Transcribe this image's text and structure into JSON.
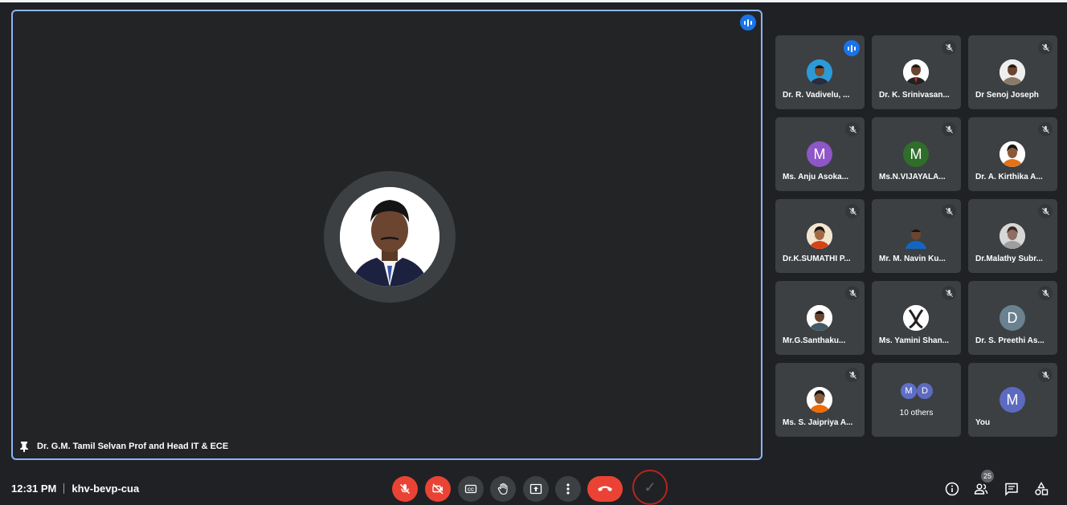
{
  "main": {
    "name": "Dr. G.M. Tamil Selvan Prof and Head IT & ECE"
  },
  "participants": [
    {
      "name": "Dr. R. Vadivelu, ...",
      "avatar": "photo",
      "speaking": true
    },
    {
      "name": "Dr. K. Srinivasan...",
      "avatar": "photo",
      "muted": true
    },
    {
      "name": "Dr Senoj Joseph",
      "avatar": "photo",
      "muted": true
    },
    {
      "name": "Ms. Anju Asoka...",
      "avatar": "letter",
      "letter": "M",
      "color": "#8e56c7",
      "muted": true
    },
    {
      "name": "Ms.N.VIJAYALA...",
      "avatar": "letter",
      "letter": "M",
      "color": "#2e6e2a",
      "muted": true
    },
    {
      "name": "Dr. A. Kirthika A...",
      "avatar": "photo",
      "muted": true
    },
    {
      "name": "Dr.K.SUMATHI P...",
      "avatar": "photo",
      "muted": true
    },
    {
      "name": "Mr. M. Navin Ku...",
      "avatar": "photo",
      "muted": true
    },
    {
      "name": "Dr.Malathy Subr...",
      "avatar": "photo",
      "muted": true
    },
    {
      "name": "Mr.G.Santhaku...",
      "avatar": "photo",
      "muted": true
    },
    {
      "name": "Ms. Yamini Shan...",
      "avatar": "photo",
      "muted": true
    },
    {
      "name": "Dr. S. Preethi As...",
      "avatar": "letter",
      "letter": "D",
      "color": "#6a8190",
      "muted": true
    },
    {
      "name": "Ms. S. Jaipriya A...",
      "avatar": "photo",
      "muted": true
    },
    {
      "name": "10 others",
      "avatar": "others",
      "letters": [
        "M",
        "D"
      ]
    },
    {
      "name": "You",
      "avatar": "letter",
      "letter": "M",
      "color": "#5c6bc0",
      "muted": true
    }
  ],
  "bottom": {
    "time": "12:31 PM",
    "meeting_code": "khv-bevp-cua",
    "people_count": "25"
  },
  "icons": [
    "pin-icon",
    "mic-off-icon",
    "camera-off-icon",
    "captions-icon",
    "raise-hand-icon",
    "present-icon",
    "more-icon",
    "end-call-icon",
    "info-icon",
    "people-icon",
    "chat-icon",
    "activities-icon"
  ]
}
